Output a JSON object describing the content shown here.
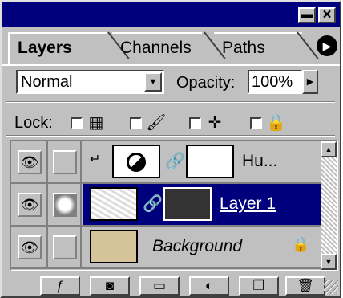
{
  "window": {
    "minimize_label": "▬",
    "close_label": "✕"
  },
  "tabs": [
    {
      "label": "Layers",
      "active": true
    },
    {
      "label": "Channels",
      "active": false
    },
    {
      "label": "Paths",
      "active": false
    }
  ],
  "menu_button": {
    "icon": "right-arrow-icon",
    "glyph": "▶"
  },
  "blend_mode": {
    "value": "Normal",
    "options": [
      "Normal"
    ]
  },
  "opacity": {
    "label": "Opacity:",
    "value": "100%"
  },
  "lock": {
    "label": "Lock:",
    "options": [
      {
        "name": "transparency",
        "icon": "checkerboard-icon",
        "glyph": "▦"
      },
      {
        "name": "image",
        "icon": "brush-icon",
        "glyph": "🖌"
      },
      {
        "name": "position",
        "icon": "move-icon",
        "glyph": "✛"
      },
      {
        "name": "all",
        "icon": "lock-icon",
        "glyph": "🔒"
      }
    ]
  },
  "layers": [
    {
      "name": "Hu...",
      "visible": true,
      "selected": false,
      "type": "adjustment"
    },
    {
      "name": "Layer 1",
      "visible": true,
      "selected": true,
      "type": "pixel"
    },
    {
      "name": "Background",
      "visible": true,
      "selected": false,
      "type": "background"
    }
  ],
  "toolbar": {
    "buttons": [
      {
        "name": "add-layer-style",
        "icon": "style-icon",
        "glyph": "ƒ"
      },
      {
        "name": "add-mask",
        "icon": "mask-icon",
        "glyph": "◙"
      },
      {
        "name": "new-set",
        "icon": "folder-icon",
        "glyph": "▭"
      },
      {
        "name": "new-adjustment",
        "icon": "adjustment-icon",
        "glyph": "◐"
      },
      {
        "name": "new-layer",
        "icon": "new-layer-icon",
        "glyph": "❐"
      },
      {
        "name": "delete-layer",
        "icon": "trash-icon",
        "glyph": "🗑"
      }
    ]
  },
  "colors": {
    "title_bar": "#00007c",
    "panel": "#c0c0c0",
    "selection": "#00007c"
  }
}
